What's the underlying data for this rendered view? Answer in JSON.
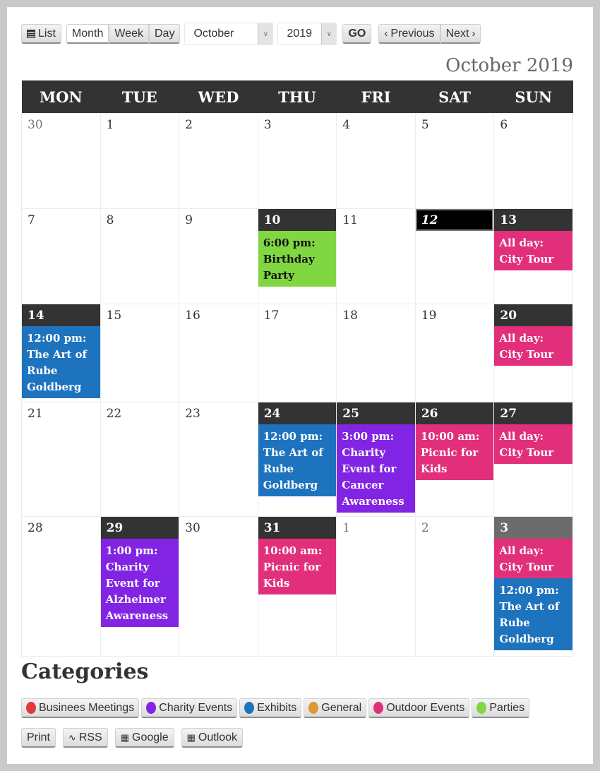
{
  "toolbar": {
    "list_label": "List",
    "views": [
      "Month",
      "Week",
      "Day"
    ],
    "active_view": "Month",
    "month_select": "October",
    "year_select": "2019",
    "go_label": "GO",
    "previous_label": "Previous",
    "next_label": "Next"
  },
  "calendar": {
    "title": "October 2019",
    "weekdays": [
      "MON",
      "TUE",
      "WED",
      "THU",
      "FRI",
      "SAT",
      "SUN"
    ],
    "weeks": [
      [
        {
          "day": "30",
          "other": true,
          "events": []
        },
        {
          "day": "1",
          "events": []
        },
        {
          "day": "2",
          "events": []
        },
        {
          "day": "3",
          "events": []
        },
        {
          "day": "4",
          "events": []
        },
        {
          "day": "5",
          "events": []
        },
        {
          "day": "6",
          "events": []
        }
      ],
      [
        {
          "day": "7",
          "events": []
        },
        {
          "day": "8",
          "events": []
        },
        {
          "day": "9",
          "events": []
        },
        {
          "day": "10",
          "events": [
            {
              "text": "6:00 pm: Birthday Party",
              "category": "parties"
            }
          ]
        },
        {
          "day": "11",
          "events": []
        },
        {
          "day": "12",
          "today": true,
          "events": []
        },
        {
          "day": "13",
          "events": [
            {
              "text": "All day: City Tour",
              "category": "outdoor"
            }
          ]
        }
      ],
      [
        {
          "day": "14",
          "events": [
            {
              "text": "12:00 pm: The Art of Rube Goldberg",
              "category": "exhibits"
            }
          ]
        },
        {
          "day": "15",
          "events": []
        },
        {
          "day": "16",
          "events": []
        },
        {
          "day": "17",
          "events": []
        },
        {
          "day": "18",
          "events": []
        },
        {
          "day": "19",
          "events": []
        },
        {
          "day": "20",
          "events": [
            {
              "text": "All day: City Tour",
              "category": "outdoor"
            }
          ]
        }
      ],
      [
        {
          "day": "21",
          "events": []
        },
        {
          "day": "22",
          "events": []
        },
        {
          "day": "23",
          "events": []
        },
        {
          "day": "24",
          "events": [
            {
              "text": "12:00 pm: The Art of Rube Goldberg",
              "category": "exhibits"
            }
          ]
        },
        {
          "day": "25",
          "events": [
            {
              "text": "3:00 pm: Charity Event for Cancer Awareness",
              "category": "charity"
            }
          ]
        },
        {
          "day": "26",
          "events": [
            {
              "text": "10:00 am: Picnic for Kids",
              "category": "outdoor"
            }
          ]
        },
        {
          "day": "27",
          "events": [
            {
              "text": "All day: City Tour",
              "category": "outdoor"
            }
          ]
        }
      ],
      [
        {
          "day": "28",
          "events": []
        },
        {
          "day": "29",
          "events": [
            {
              "text": "1:00 pm: Charity Event for Alzheimer Awareness",
              "category": "charity"
            }
          ]
        },
        {
          "day": "30",
          "events": []
        },
        {
          "day": "31",
          "events": [
            {
              "text": "10:00 am: Picnic for Kids",
              "category": "outdoor"
            }
          ]
        },
        {
          "day": "1",
          "other": true,
          "events": []
        },
        {
          "day": "2",
          "other": true,
          "events": []
        },
        {
          "day": "3",
          "other": true,
          "events": [
            {
              "text": "All day: City Tour",
              "category": "outdoor"
            },
            {
              "text": "12:00 pm: The Art of Rube Goldberg",
              "category": "exhibits"
            }
          ]
        }
      ]
    ]
  },
  "categories": {
    "heading": "Categories",
    "items": [
      {
        "key": "business",
        "label": "Businees Meetings",
        "color": "#e03a3e"
      },
      {
        "key": "charity",
        "label": "Charity Events",
        "color": "#8224e3"
      },
      {
        "key": "exhibits",
        "label": "Exhibits",
        "color": "#1e73be"
      },
      {
        "key": "general",
        "label": "General",
        "color": "#dd9933"
      },
      {
        "key": "outdoor",
        "label": "Outdoor Events",
        "color": "#e22f7b"
      },
      {
        "key": "parties",
        "label": "Parties",
        "color": "#81d742"
      }
    ]
  },
  "actions": {
    "print_label": "Print",
    "rss_label": "RSS",
    "google_label": "Google",
    "outlook_label": "Outlook"
  }
}
